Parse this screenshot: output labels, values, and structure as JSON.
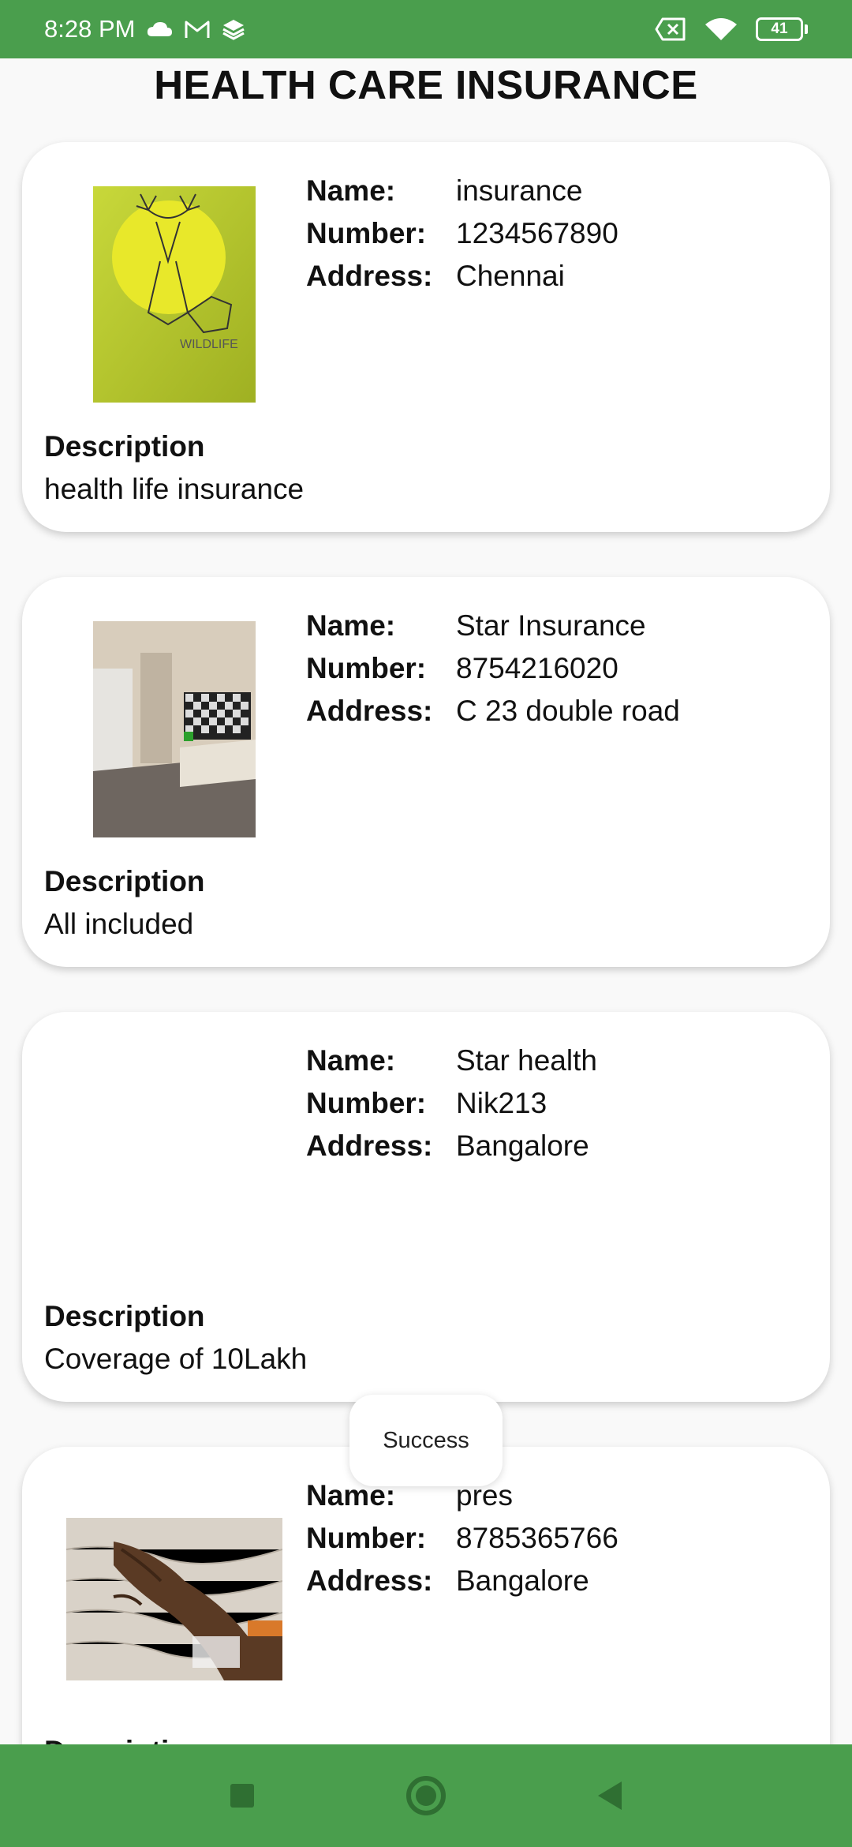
{
  "status_bar": {
    "time": "8:28 PM",
    "battery": "41",
    "icons": [
      "cloud-icon",
      "gmail-icon",
      "layers-icon",
      "sim-off-icon",
      "wifi-icon",
      "battery-icon"
    ]
  },
  "header": {
    "title": "HEALTH CARE INSURANCE"
  },
  "labels": {
    "name": "Name:",
    "number": "Number:",
    "address": "Address:",
    "description": "Description"
  },
  "cards": [
    {
      "name": "insurance",
      "number": "1234567890",
      "address": "Chennai",
      "description": "health life insurance",
      "image": "deer-wildlife-poster"
    },
    {
      "name": "Star Insurance",
      "number": "8754216020",
      "address": "C 23 double road",
      "description": "All included",
      "image": "room-with-tv"
    },
    {
      "name": "Star health",
      "number": "Nik213",
      "address": "Bangalore",
      "description": "Coverage of 10Lakh",
      "image": ""
    },
    {
      "name": "pres",
      "number": "8785365766",
      "address": "Bangalore",
      "description": "",
      "image": "hand-on-fabric"
    }
  ],
  "toast": {
    "text": "Success"
  },
  "colors": {
    "accent": "#4a9e4d",
    "card": "#ffffff",
    "background": "#f9f9f9"
  }
}
